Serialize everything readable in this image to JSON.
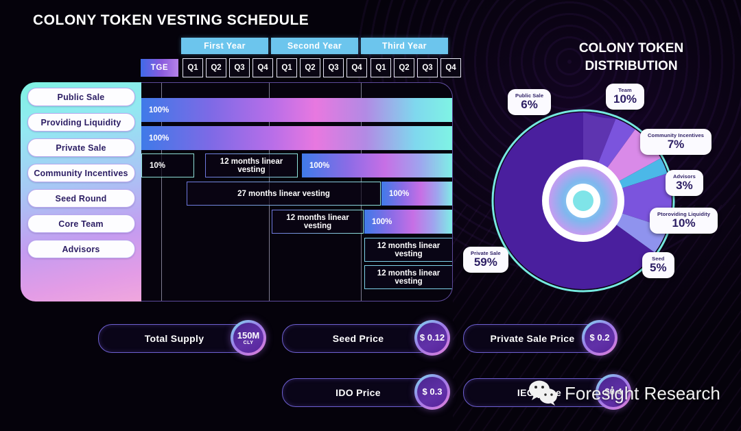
{
  "header": {
    "title": "COLONY TOKEN VESTING SCHEDULE"
  },
  "timeline": {
    "tge_label": "TGE",
    "years": [
      {
        "label": "First Year",
        "quarters": [
          "Q1",
          "Q2",
          "Q3",
          "Q4"
        ]
      },
      {
        "label": "Second Year",
        "quarters": [
          "Q1",
          "Q2",
          "Q3",
          "Q4"
        ]
      },
      {
        "label": "Third Year",
        "quarters": [
          "Q1",
          "Q2",
          "Q3",
          "Q4"
        ]
      }
    ]
  },
  "schedule": {
    "categories": [
      "Public Sale",
      "Providing Liquidity",
      "Private Sale",
      "Community Incentives",
      "Seed Round",
      "Core Team",
      "Advisors"
    ],
    "rows": [
      {
        "category": "Public Sale",
        "segments": [
          {
            "type": "filled",
            "label": "100%",
            "start_pct": 0,
            "width_pct": 100
          }
        ]
      },
      {
        "category": "Providing Liquidity",
        "segments": [
          {
            "type": "filled",
            "label": "100%",
            "start_pct": 0,
            "width_pct": 100
          }
        ]
      },
      {
        "category": "Private Sale",
        "segments": [
          {
            "type": "tge",
            "label": "10%",
            "start_pct": 0,
            "width_pct": 17
          },
          {
            "type": "outline",
            "label": "12 months linear vesting",
            "start_pct": 20.5,
            "width_pct": 30
          },
          {
            "type": "filled",
            "label": "100%",
            "start_pct": 51.5,
            "width_pct": 48.5
          }
        ]
      },
      {
        "category": "Community Incentives",
        "segments": [
          {
            "type": "outline",
            "label": "27 months linear vesting",
            "start_pct": 14.5,
            "width_pct": 62
          },
          {
            "type": "filled",
            "label": "100%",
            "start_pct": 77,
            "width_pct": 23
          }
        ]
      },
      {
        "category": "Seed Round",
        "segments": [
          {
            "type": "outline",
            "label": "12 months linear vesting",
            "start_pct": 42,
            "width_pct": 29.5
          },
          {
            "type": "filled",
            "label": "100%",
            "start_pct": 71.8,
            "width_pct": 28.2
          }
        ]
      },
      {
        "category": "Core Team",
        "segments": [
          {
            "type": "outline2",
            "label": "12 months linear vesting",
            "start_pct": 71.8,
            "width_pct": 28.2
          }
        ]
      },
      {
        "category": "Advisors",
        "segments": [
          {
            "type": "outline2",
            "label": "12 months linear vesting",
            "start_pct": 71.8,
            "width_pct": 28.2
          }
        ]
      }
    ]
  },
  "distribution": {
    "title_line1": "COLONY TOKEN",
    "title_line2": "DISTRIBUTION"
  },
  "stats": [
    {
      "label": "Total Supply",
      "value": "150M",
      "unit": "CLY"
    },
    {
      "label": "Seed Price",
      "value": "$ 0.12",
      "unit": ""
    },
    {
      "label": "Private Sale Price",
      "value": "$ 0.2",
      "unit": ""
    },
    {
      "label": "IDO Price",
      "value": "$ 0.3",
      "unit": ""
    },
    {
      "label": "IEO price",
      "value": "$0.4",
      "unit": ""
    }
  ],
  "watermark": {
    "text": "Foresight Research",
    "icon": "wechat-icon"
  },
  "chart_data": {
    "type": "pie",
    "title": "COLONY TOKEN DISTRIBUTION",
    "categories": [
      "Private Sale",
      "Team",
      "Community Incentives",
      "Advisors",
      "Ptoroviding Liquidity",
      "Seed",
      "Public Sale"
    ],
    "values": [
      59,
      10,
      7,
      3,
      10,
      5,
      6
    ],
    "labels": [
      "59%",
      "10%",
      "7%",
      "3%",
      "10%",
      "5%",
      "6%"
    ],
    "colors": [
      "#4a1f9e",
      "#7b54dd",
      "#d98ae8",
      "#4bb8e8",
      "#7b54dd",
      "#8f93ee",
      "#5e34b0"
    ],
    "legend_position": "callout-pills",
    "ring": true,
    "annotations": [
      {
        "name": "Public Sale",
        "pct": "6%"
      },
      {
        "name": "Team",
        "pct": "10%"
      },
      {
        "name": "Community Incentives",
        "pct": "7%"
      },
      {
        "name": "Advisors",
        "pct": "3%"
      },
      {
        "name": "Ptoroviding Liquidity",
        "pct": "10%"
      },
      {
        "name": "Seed",
        "pct": "5%"
      },
      {
        "name": "Private Sale",
        "pct": "59%"
      }
    ]
  }
}
